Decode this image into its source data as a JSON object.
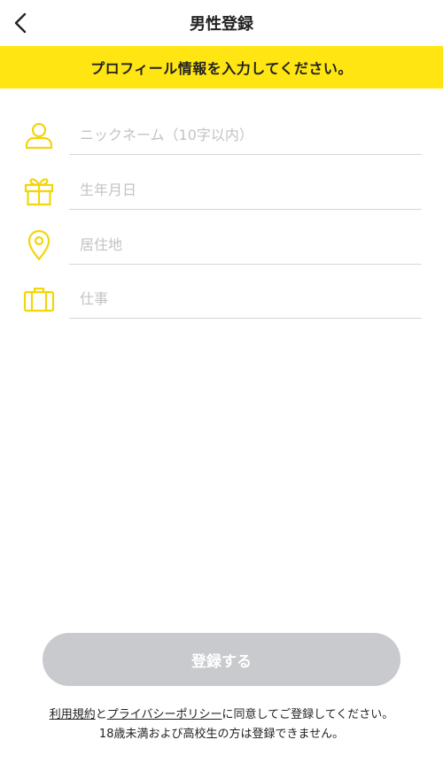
{
  "header": {
    "title": "男性登録",
    "back_icon": "chevron-left-icon"
  },
  "banner": {
    "text": "プロフィール情報を入力してください。",
    "color": "#FFE512"
  },
  "fields": [
    {
      "icon": "user-icon",
      "placeholder": "ニックネーム（10字以内）",
      "value": ""
    },
    {
      "icon": "gift-icon",
      "placeholder": "生年月日",
      "value": ""
    },
    {
      "icon": "location-pin-icon",
      "placeholder": "居住地",
      "value": ""
    },
    {
      "icon": "briefcase-icon",
      "placeholder": "仕事",
      "value": ""
    }
  ],
  "submit": {
    "label": "登録する",
    "state": "disabled"
  },
  "terms": {
    "terms_link": "利用規約",
    "connector": "と",
    "privacy_link": "プライバシーポリシー",
    "agreement": "に同意してご登録してください。",
    "age_notice": "18歳未満および高校生の方は登録できません。"
  },
  "colors": {
    "accent": "#FFE512",
    "icon": "#F2D60C",
    "button_disabled": "#C9CACE",
    "placeholder": "#C3C3C3",
    "divider": "#D6D6D6"
  }
}
